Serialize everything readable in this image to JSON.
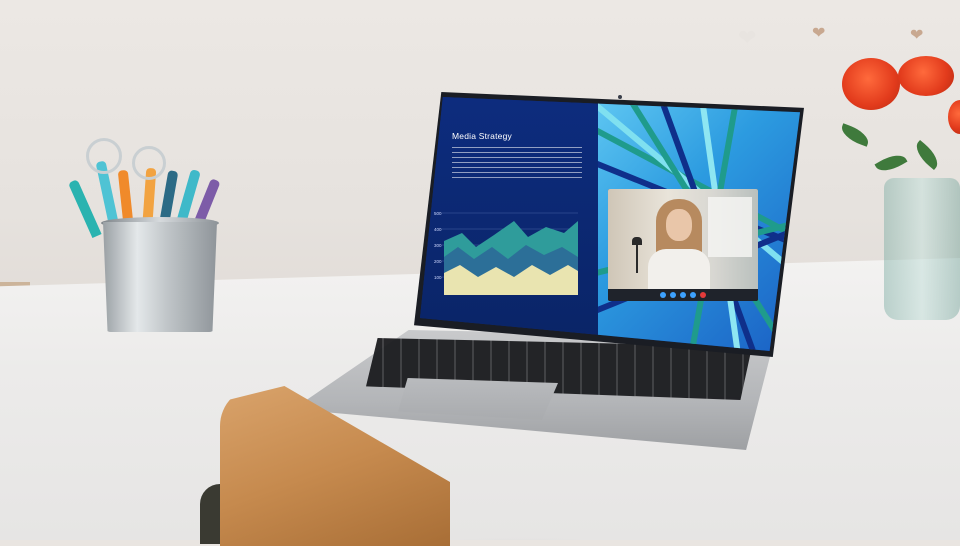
{
  "scene": {
    "laptop": {
      "slide": {
        "title": "Media Strategy",
        "chart_y_ticks": [
          "500",
          "400",
          "300",
          "200",
          "100"
        ]
      },
      "video_call": {
        "buttons": [
          "mic-icon",
          "camera-icon",
          "share-icon",
          "settings-icon",
          "end-call-icon"
        ]
      }
    },
    "colors": {
      "slide_bg": "#0d2c7e",
      "art_light": "#5fc7f2",
      "art_dark": "#1a5fc4",
      "stripe_green": "#1f9b8c",
      "chart_teal": "#2f9c9b",
      "chart_light": "#e9e4b0",
      "flower": "#e23b1c"
    }
  }
}
